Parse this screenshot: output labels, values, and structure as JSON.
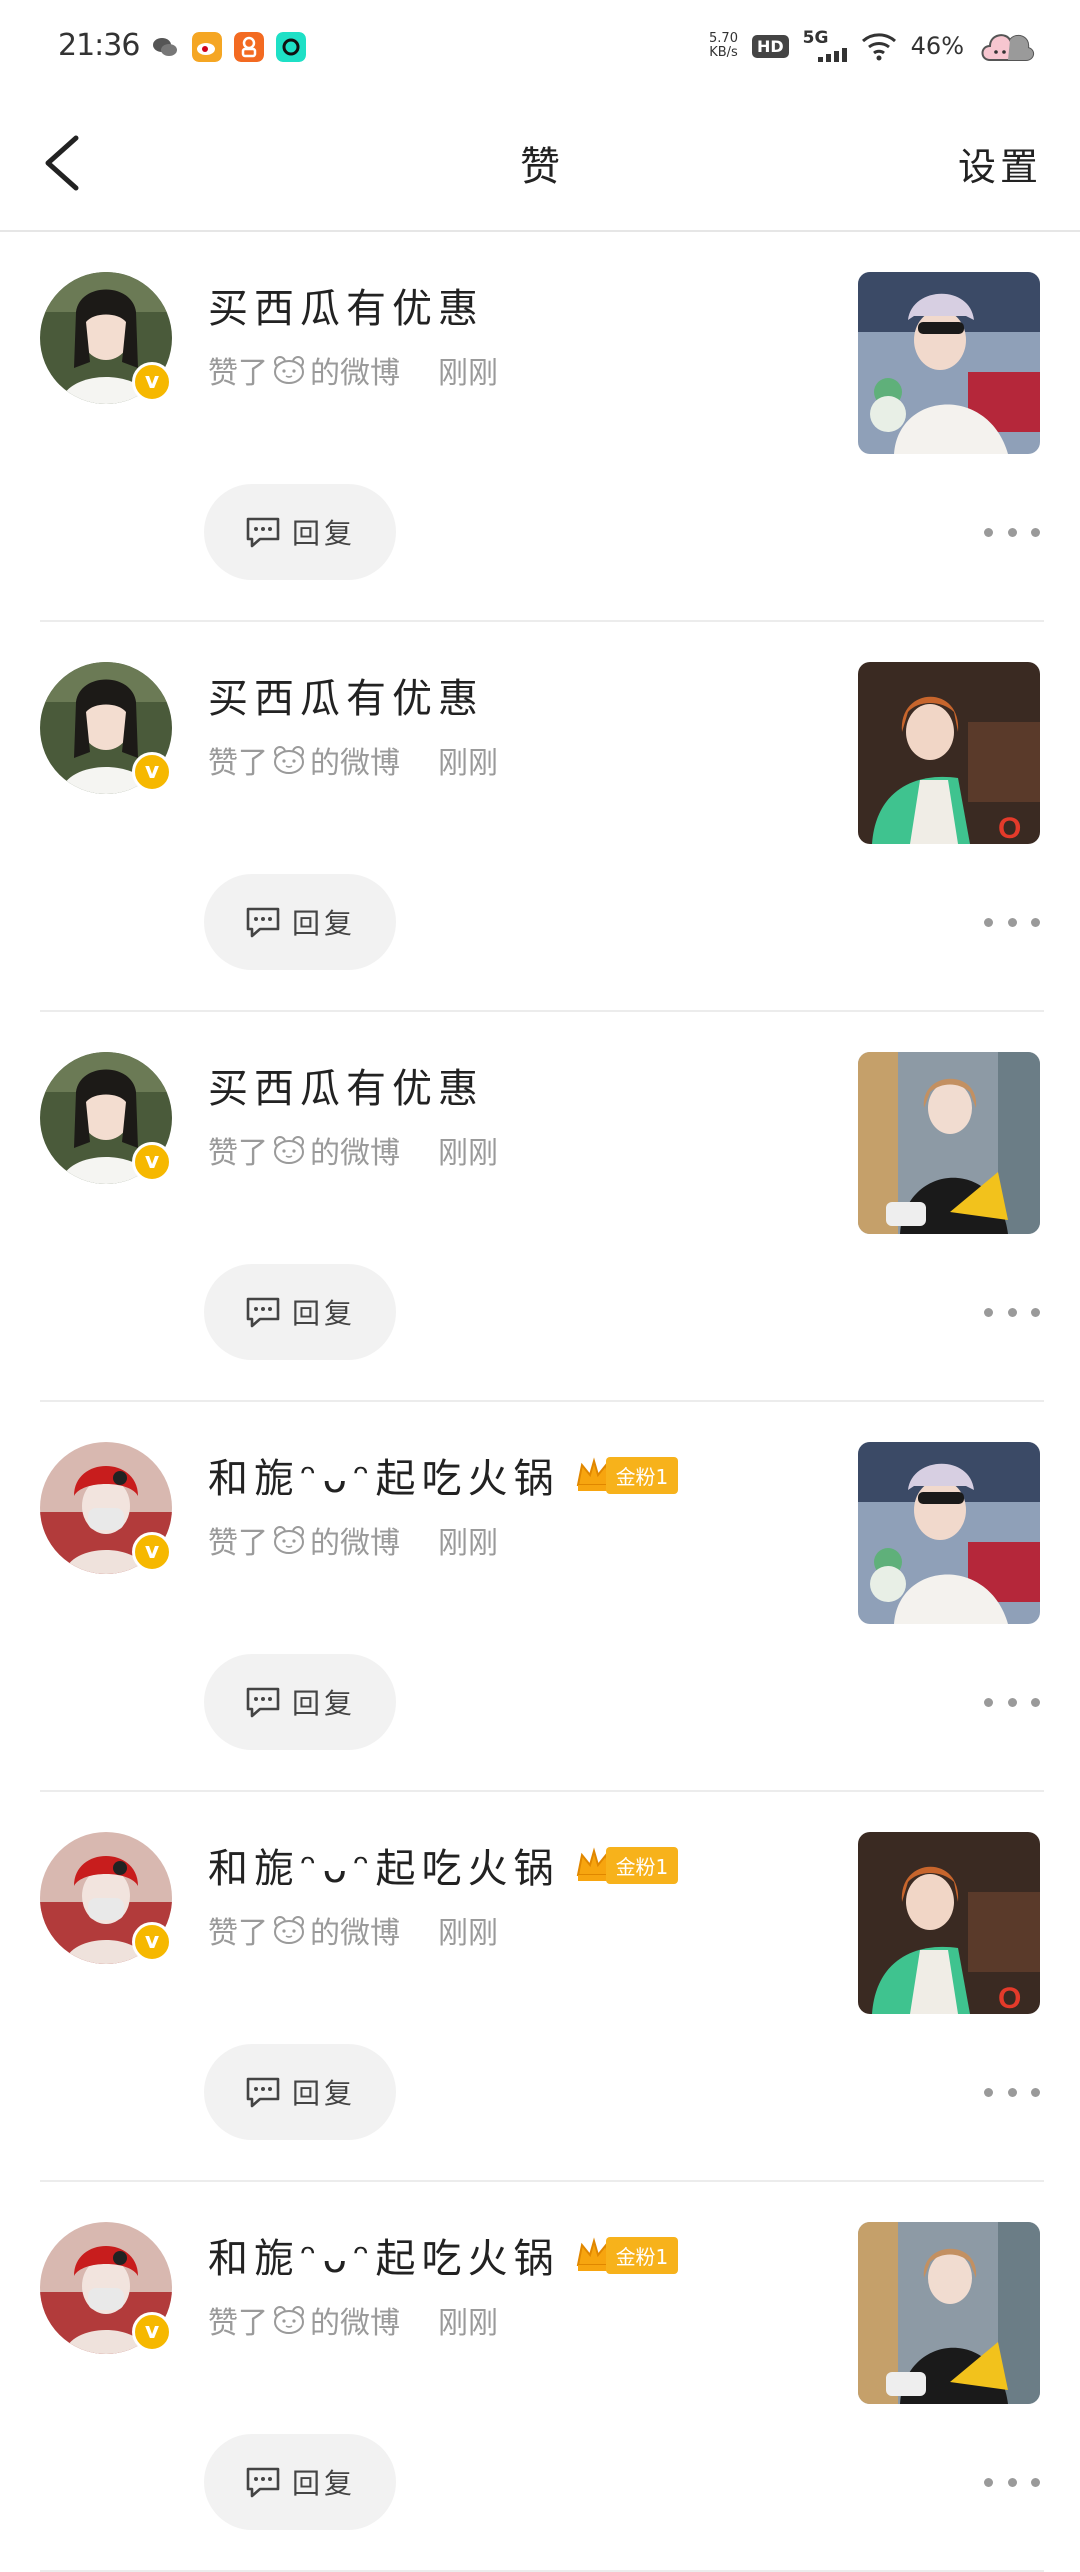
{
  "status_bar": {
    "time": "21:36",
    "net_speed_value": "5.70",
    "net_speed_unit": "KB/s",
    "hd": "HD",
    "network": "5G",
    "battery": "46%",
    "apps": [
      "wechat-icon",
      "weibo-icon",
      "app-orange-icon",
      "app-teal-icon"
    ]
  },
  "header": {
    "title": "赞",
    "settings": "设置",
    "back_icon": "chevron-left-icon"
  },
  "items": [
    {
      "name": "买西瓜有优惠",
      "fan_badge": "",
      "liked": "赞了",
      "target": "的微博",
      "time": "刚刚",
      "reply": "回复",
      "avatar": "a",
      "thumb": "t1"
    },
    {
      "name": "买西瓜有优惠",
      "fan_badge": "",
      "liked": "赞了",
      "target": "的微博",
      "time": "刚刚",
      "reply": "回复",
      "avatar": "a",
      "thumb": "t2"
    },
    {
      "name": "买西瓜有优惠",
      "fan_badge": "",
      "liked": "赞了",
      "target": "的微博",
      "time": "刚刚",
      "reply": "回复",
      "avatar": "a",
      "thumb": "t3"
    },
    {
      "name": "和旎ᵔᴗᵔ起吃火锅",
      "fan_badge": "金粉1",
      "liked": "赞了",
      "target": "的微博",
      "time": "刚刚",
      "reply": "回复",
      "avatar": "b",
      "thumb": "t1"
    },
    {
      "name": "和旎ᵔᴗᵔ起吃火锅",
      "fan_badge": "金粉1",
      "liked": "赞了",
      "target": "的微博",
      "time": "刚刚",
      "reply": "回复",
      "avatar": "b",
      "thumb": "t2"
    },
    {
      "name": "和旎ᵔᴗᵔ起吃火锅",
      "fan_badge": "金粉1",
      "liked": "赞了",
      "target": "的微博",
      "time": "刚刚",
      "reply": "回复",
      "avatar": "b",
      "thumb": "t3"
    }
  ],
  "colors": {
    "accent": "#f6b800",
    "fan_badge": "#f7b21b",
    "secondary_text": "#9a9a9a",
    "reply_bg": "#f2f2f2"
  }
}
